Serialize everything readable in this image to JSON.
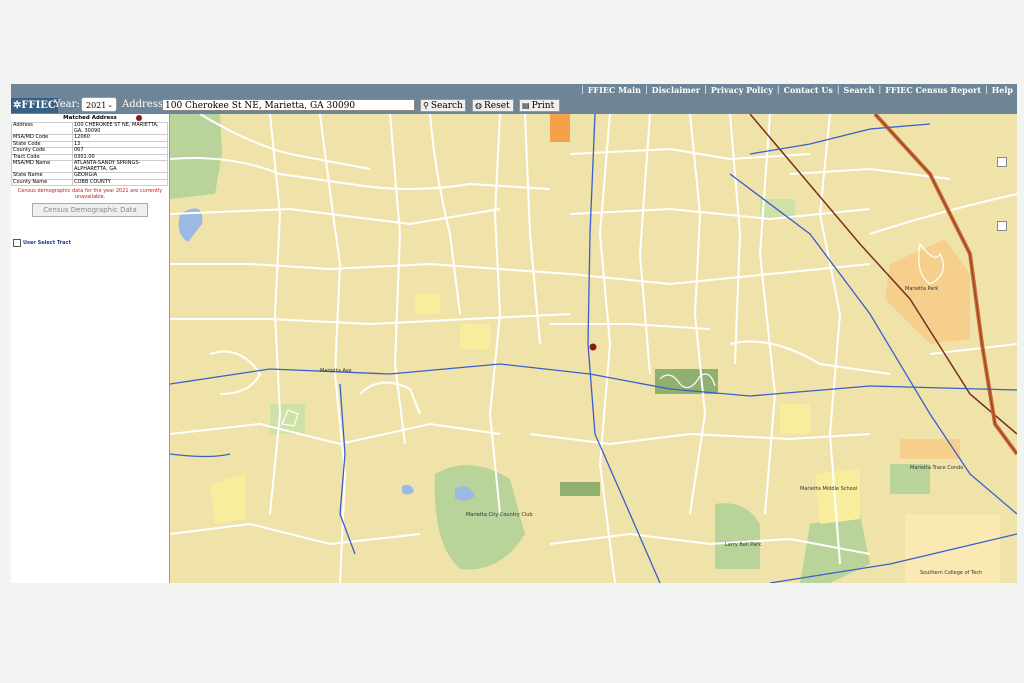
{
  "nav": {
    "links": [
      "FFIEC Main",
      "Disclaimer",
      "Privacy Policy",
      "Contact Us",
      "Search",
      "FFIEC Census Report",
      "Help"
    ]
  },
  "toolbar": {
    "logo": "FFIEC",
    "year_label": "Year:",
    "year_value": "2021",
    "address_label": "Address:",
    "address_value": "100 Cherokee St NE, Marietta, GA 30090",
    "search_label": "Search",
    "reset_label": "Reset",
    "print_label": "Print"
  },
  "side": {
    "header": "Matched Address",
    "rows": [
      {
        "k": "Address",
        "v": "100 CHEROKEE ST NE, MARIETTA, GA, 30090"
      },
      {
        "k": "MSA/MD Code",
        "v": "12060"
      },
      {
        "k": "State Code",
        "v": "13"
      },
      {
        "k": "County Code",
        "v": "067"
      },
      {
        "k": "Tract Code",
        "v": "0301.00"
      },
      {
        "k": "MSA/MD Name",
        "v": "ATLANTA-SANDY SPRINGS-ALPHARETTA, GA"
      },
      {
        "k": "State Name",
        "v": "GEORGIA"
      },
      {
        "k": "County Name",
        "v": "COBB COUNTY"
      }
    ],
    "warning": "Census demographic data for the year 2021 are currently unavailable.",
    "census_button": "Census Demographic Data",
    "user_select": "User Select Tract"
  },
  "map": {
    "labels": [
      "Marietta City Country Club",
      "Marietta Trace Condo",
      "Marietta Middle School",
      "Larry Bell Park",
      "Southern College of Tech",
      "Marietta Park",
      "Marietta Ave"
    ],
    "colors": {
      "land": "#efe3a9",
      "road": "#ffffff",
      "highway": "#3a5fcd",
      "rail": "#7a3020",
      "park": "#b9d49a",
      "water": "#9db8e2",
      "campus": "#f7cf8c"
    }
  }
}
